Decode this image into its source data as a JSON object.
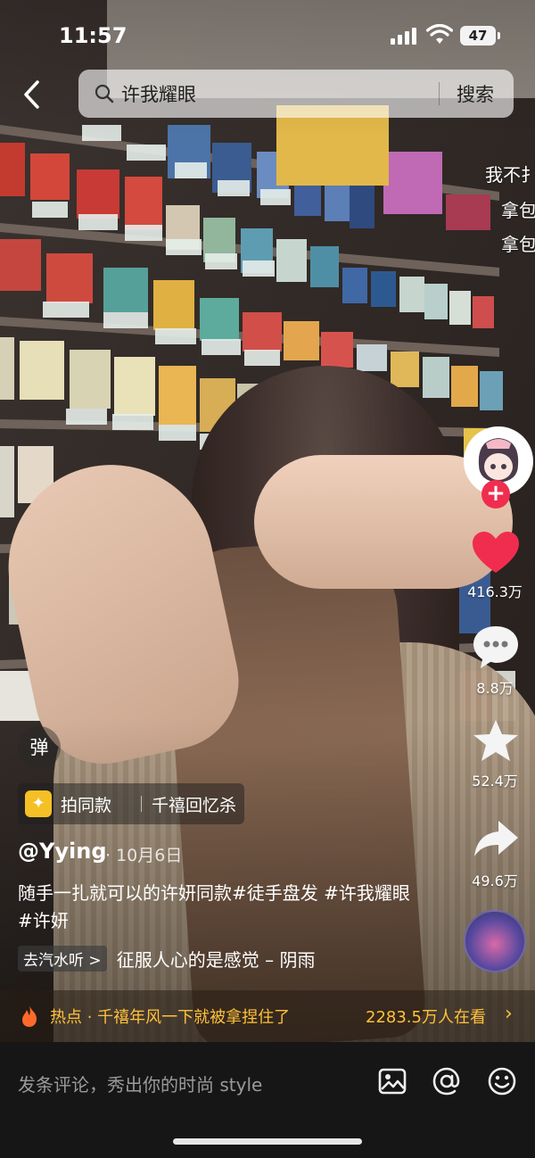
{
  "status_bar": {
    "time": "11:57",
    "battery": "47"
  },
  "search": {
    "query": "许我耀眼",
    "button": "搜索"
  },
  "edge_texts": [
    "我不扌",
    "拿包",
    "拿包"
  ],
  "rail": {
    "like_count": "416.3万",
    "comment_count": "8.8万",
    "favorite_count": "52.4万",
    "share_count": "49.6万"
  },
  "danmaku": "弹",
  "chip": {
    "left": "拍同款",
    "right": "千禧回忆杀"
  },
  "post": {
    "author": "@Yying",
    "date": "· 10月6日",
    "description": "随手一扎就可以的许妍同款#徒手盘发 #许我耀眼#许妍"
  },
  "music": {
    "chip": "去汽水听 >",
    "song": "征服人心的是感觉 – 阴雨"
  },
  "hot": {
    "text": "热点 · 千禧年风一下就被拿捏住了",
    "viewers": "2283.5万人在看",
    "chevron": "›"
  },
  "comment": {
    "placeholder": "发条评论，秀出你的时尚 style"
  },
  "colors": {
    "like_red": "#f02d4f",
    "hot_gold": "#ffc23a",
    "bottom_bg": "#161616"
  }
}
